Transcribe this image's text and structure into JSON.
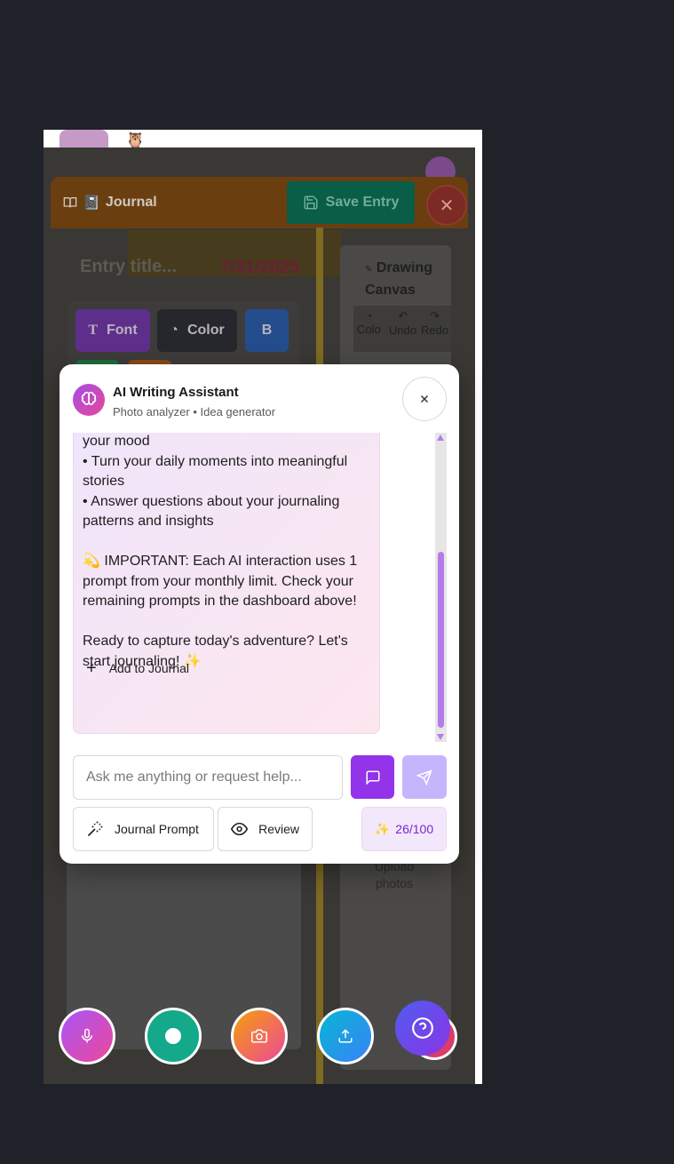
{
  "journal": {
    "title": "Journal",
    "save_label": "Save Entry",
    "entry_title_placeholder": "Entry title...",
    "date": "7/31/2025"
  },
  "toolbar": {
    "font_label": "Font",
    "color_label": "Color",
    "bold_label": "B"
  },
  "drawing": {
    "title": "Drawing Canvas",
    "tools": [
      "Colo",
      "Undo",
      "Redo"
    ],
    "upload_caption": "Upload photos"
  },
  "dialog": {
    "title": "AI Writing Assistant",
    "subtitle": "Photo analyzer • Idea generator",
    "message_lines": [
      "your mood",
      "• Turn your daily moments into meaningful stories",
      "• Answer questions about your journaling patterns and insights",
      "",
      "💫 IMPORTANT: Each AI interaction uses 1 prompt from your monthly limit. Check your remaining prompts in the dashboard above!",
      "",
      "Ready to capture today's adventure? Let's start journaling! ✨"
    ],
    "add_to_journal_label": "Add to Journal",
    "input_placeholder": "Ask me anything or request help...",
    "journal_prompt_label": "Journal Prompt",
    "review_label": "Review",
    "quota_icon": "✨",
    "quota_text": "26/100"
  },
  "colors": {
    "accent": "#9333ea",
    "send_disabled": "#c4b5fd",
    "save_green": "#0f8a66"
  }
}
